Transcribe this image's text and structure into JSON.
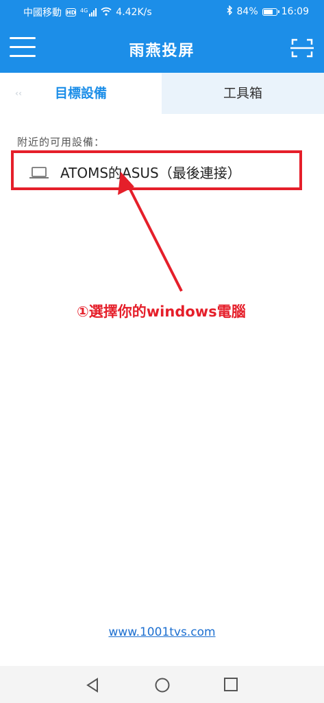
{
  "status_bar": {
    "carrier": "中國移動",
    "hd_badge": "HD",
    "network_type": "4G",
    "speed": "4.42K/s",
    "bluetooth_icon": "bluetooth-icon",
    "battery_percent": "84%",
    "battery_level": 0.84,
    "time": "16:09"
  },
  "app_bar": {
    "title": "雨燕投屏",
    "menu_icon": "hamburger-menu-icon",
    "scan_icon": "scan-icon"
  },
  "tabs": [
    {
      "label": "目標設備",
      "active": true
    },
    {
      "label": "工具箱",
      "active": false
    }
  ],
  "devices_section": {
    "label": "附近的可用設備：",
    "items": [
      {
        "name": "ATOMS的ASUS（最後連接）",
        "icon": "laptop-icon"
      }
    ]
  },
  "annotation": {
    "text": "①選擇你的windows電腦",
    "color": "#e51f2a"
  },
  "footer": {
    "link_text": "www.1001tvs.com"
  },
  "colors": {
    "primary": "#1c8ee8",
    "highlight": "#e51f2a"
  },
  "nav_bar": {
    "back_icon": "back-triangle-icon",
    "home_icon": "home-circle-icon",
    "recents_icon": "recents-square-icon"
  }
}
